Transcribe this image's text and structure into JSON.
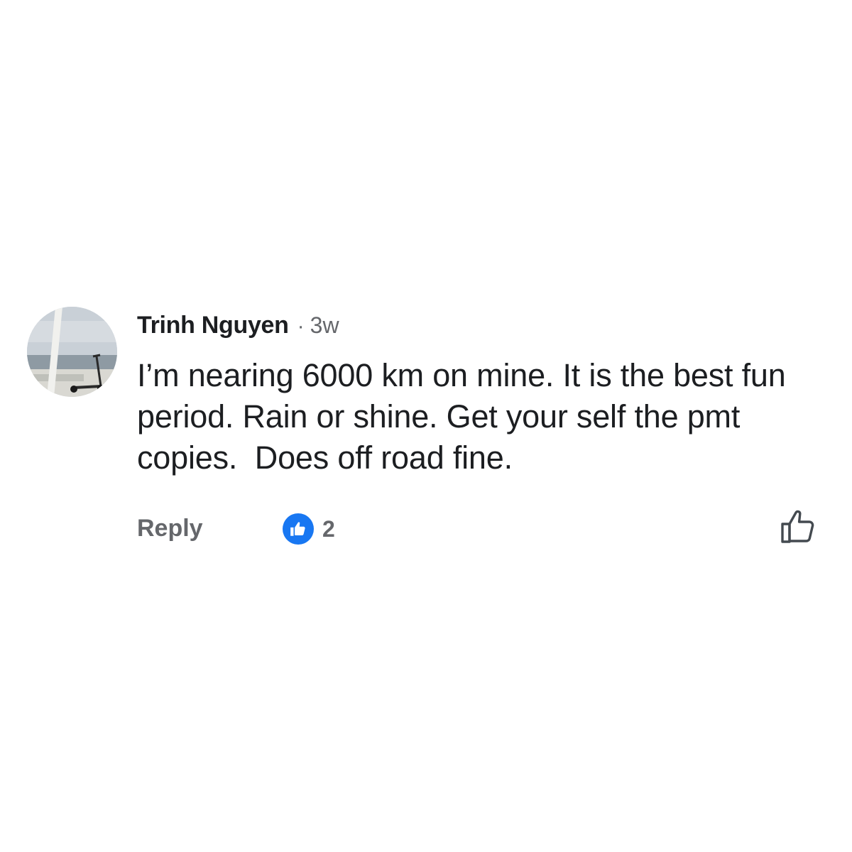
{
  "comment": {
    "author": "Trinh Nguyen",
    "separator": "·",
    "timestamp": "3w",
    "text": "I’m nearing 6000 km on mine. It is the best fun period. Rain or shine. Get your self the pmt copies.  Does off road fine.",
    "avatar_icon": "profile-photo",
    "actions": {
      "reply_label": "Reply",
      "reaction_icon": "like-reaction-icon",
      "reaction_count": "2",
      "like_icon": "thumbs-up-outline-icon"
    }
  },
  "colors": {
    "primary_text": "#1c1e21",
    "secondary_text": "#65676b",
    "reaction_blue": "#1877f2",
    "background": "#ffffff"
  }
}
